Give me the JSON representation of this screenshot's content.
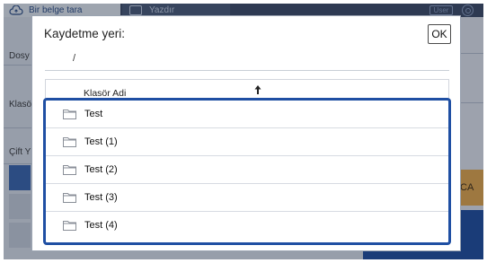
{
  "background": {
    "tabs": [
      {
        "label": "Bir belge tara"
      },
      {
        "label": "Yazdır"
      }
    ],
    "user_label": "User",
    "left_labels": [
      "Dosy",
      "Klasö",
      "Çift Y"
    ],
    "ca_label": "CA"
  },
  "dialog": {
    "title": "Kaydetme yeri:",
    "ok_label": "OK",
    "path": "/",
    "column_header": "Klasör Adi",
    "folders": [
      {
        "label": "Test"
      },
      {
        "label": "Test (1)"
      },
      {
        "label": "Test (2)"
      },
      {
        "label": "Test (3)"
      },
      {
        "label": "Test (4)"
      }
    ]
  },
  "colors": {
    "highlight_border": "#1f4fa3",
    "ok_border": "#4a4a4a",
    "background_blue": "#1e4ea0",
    "ca_orange": "#e9a94b"
  },
  "icons": {
    "tab_scan": "cloud-upload-icon",
    "tab_copy": "printer-icon",
    "settings": "gear-icon",
    "sort": "arrow-up-icon",
    "folder": "folder-icon"
  }
}
